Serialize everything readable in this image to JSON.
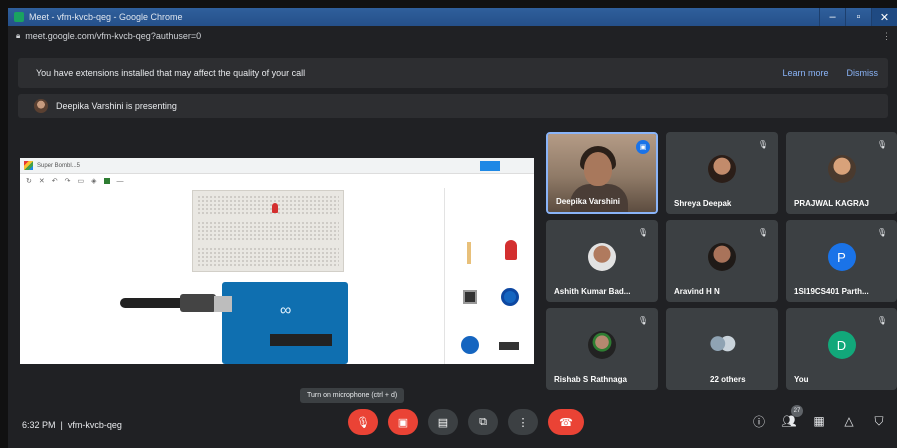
{
  "window": {
    "title": "Meet - vfm-kvcb-qeg - Google Chrome",
    "url": "meet.google.com/vfm-kvcb-qeg?authuser=0"
  },
  "warning": {
    "text": "You have extensions installed that may affect the quality of your call",
    "learn_more": "Learn more",
    "dismiss": "Dismiss"
  },
  "presenting": {
    "text": "Deepika Varshini is presenting"
  },
  "shared_screen": {
    "tab_title": "Super Bombl...5"
  },
  "participants": [
    {
      "name": "Deepika Varshini",
      "kind": "video"
    },
    {
      "name": "Shreya Deepak",
      "kind": "photo"
    },
    {
      "name": "PRAJWAL KAGRAJ",
      "kind": "photo"
    },
    {
      "name": "Ashith Kumar Bad...",
      "kind": "photo"
    },
    {
      "name": "Aravind H N",
      "kind": "photo"
    },
    {
      "name": "1SI19CS401 Parth...",
      "kind": "letter",
      "letter": "P",
      "color": "#1a73e8"
    },
    {
      "name": "Rishab S Rathnaga",
      "kind": "photo"
    },
    {
      "name": "22 others",
      "kind": "group"
    },
    {
      "name": "You",
      "kind": "letter",
      "letter": "D",
      "color": "#12a87a"
    }
  ],
  "tooltip": "Turn on microphone (ctrl + d)",
  "bottom": {
    "time": "6:32 PM",
    "meeting_code": "vfm-kvcb-qeg",
    "people_count": "27"
  },
  "icons": {
    "mic": "mic-off-icon",
    "camera": "camera-off-icon",
    "captions": "captions-icon",
    "present": "present-icon",
    "more": "more-vert-icon",
    "hangup": "hangup-icon",
    "info": "info-icon",
    "people": "people-icon",
    "chat": "chat-icon",
    "activities": "activities-icon",
    "lock": "shield-icon"
  }
}
